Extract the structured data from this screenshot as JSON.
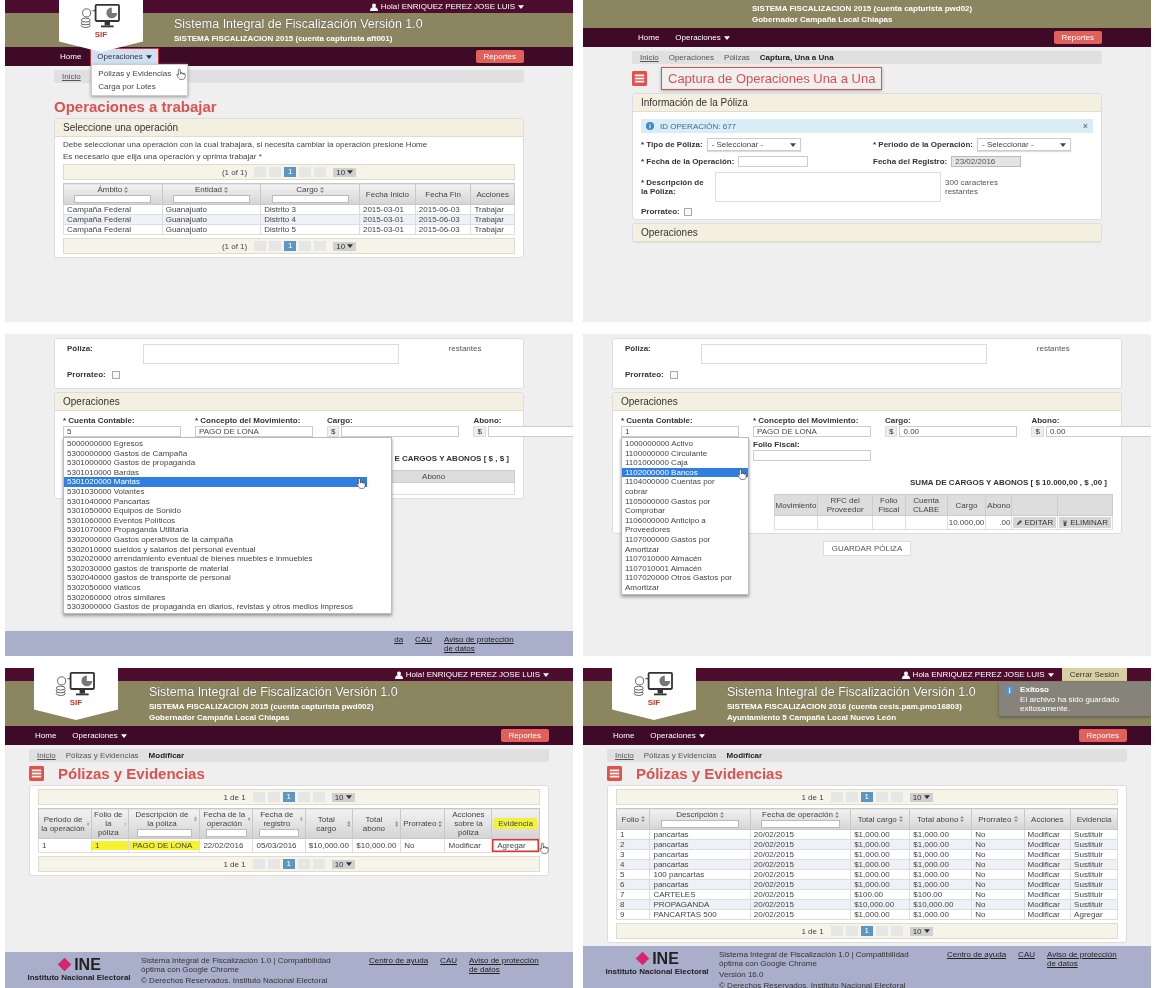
{
  "panels": [
    {
      "header": {
        "logo": "SIF",
        "user": "Hola! ENRIQUEZ PEREZ JOSE LUIS",
        "title": "Sistema Integral de Fiscalización Versión 1.0",
        "subtitles": [
          "SISTEMA FISCALIZACION 2015 (cuenta capturista aft001)"
        ],
        "nav": [
          {
            "label": "Home",
            "selected": false,
            "dropdown": false
          },
          {
            "label": "Operaciones",
            "selected": true,
            "dropdown": true,
            "menu": [
              {
                "label": "Pólizas y Evidencias",
                "hovered": true
              },
              {
                "label": "Carga por Lotes",
                "hovered": false
              }
            ]
          }
        ],
        "reports": "Reportes"
      },
      "sections": [
        {
          "kind": "breadcrumb",
          "items": [
            "Inicio"
          ]
        },
        {
          "kind": "heading",
          "text": "Operaciones a trabajar",
          "icon": false,
          "outlined": false
        },
        {
          "kind": "card",
          "title": "Seleccione una operación",
          "blocks": [
            {
              "kind": "paragraph",
              "text": "Debe seleccionar una operación con la cual trabajará, si necesita cambiar la operación presione Home"
            },
            {
              "kind": "paragraph",
              "text": "Es necesario que elija una operación y oprima trabajar *"
            },
            {
              "kind": "pager",
              "label": "(1 of 1)",
              "pages": [
                {
                  "label": "1",
                  "selected": true
                }
              ],
              "size": "10"
            },
            {
              "kind": "table",
              "columns": [
                {
                  "label": "Ámbito",
                  "sort": true,
                  "filter": true
                },
                {
                  "label": "Entidad",
                  "sort": true,
                  "filter": true
                },
                {
                  "label": "Cargo",
                  "sort": true,
                  "filter": true
                },
                {
                  "label": "Fecha Inicio",
                  "sort": false,
                  "filter": false
                },
                {
                  "label": "Fecha Fin",
                  "sort": false,
                  "filter": false
                },
                {
                  "label": "Acciones",
                  "sort": false,
                  "filter": false
                }
              ],
              "rows": [
                [
                  "Campaña Federal",
                  "Guanajuato",
                  "Distrito 3",
                  "2015-03-01",
                  "2015-06-03",
                  "Trabajar"
                ],
                [
                  "Campaña Federal",
                  "Guanajuato",
                  "Distrito 4",
                  "2015-03-01",
                  "2015-06-03",
                  "Trabajar"
                ],
                [
                  "Campaña Federal",
                  "Guanajuato",
                  "Distrito 5",
                  "2015-03-01",
                  "2015-06-03",
                  "Trabajar"
                ]
              ]
            },
            {
              "kind": "pager",
              "label": "(1 of 1)",
              "pages": [
                {
                  "label": "1",
                  "selected": true
                }
              ],
              "size": "10"
            }
          ]
        }
      ]
    },
    {
      "header": {
        "subtitles": [
          "SISTEMA FISCALIZACION 2015 (cuenta capturista pwd02)",
          "Gobernador Campaña Local Chiapas"
        ],
        "nav": [
          {
            "label": "Home",
            "selected": false,
            "dropdown": false
          },
          {
            "label": "Operaciones",
            "selected": false,
            "dropdown": true
          }
        ],
        "reports": "Reportes"
      },
      "sections": [
        {
          "kind": "breadcrumb",
          "items": [
            "Inicio",
            "Operaciones",
            "Pólizas",
            "Captura, Una a Una"
          ]
        },
        {
          "kind": "heading",
          "text": "Captura de Operaciones Una a Una",
          "icon": true,
          "outlined": true
        },
        {
          "kind": "card",
          "title": "Información de la Póliza",
          "blocks": [
            {
              "kind": "alert",
              "text": "ID OPERACIÓN: 677",
              "close": "×"
            },
            {
              "kind": "form_inline",
              "fields": [
                {
                  "kind": "select",
                  "label": "* Tipo de Póliza:",
                  "value": "- Seleccionar -"
                },
                {
                  "kind": "select",
                  "label": "* Periodo de la Operación:",
                  "value": "- Seleccionar -"
                },
                {
                  "kind": "input",
                  "label": "* Fecha de la Operación:",
                  "disabled": false
                },
                {
                  "kind": "input",
                  "label": "Fecha del Registro:",
                  "value": "23/02/2016",
                  "disabled": true
                },
                {
                  "kind": "textarea",
                  "label": "* Descripción de la Póliza:",
                  "note": "300 caracteres restantes"
                },
                {
                  "kind": "checkbox",
                  "label": "Prorrateo:",
                  "checked": false
                }
              ]
            }
          ]
        },
        {
          "kind": "card",
          "title": "Operaciones"
        }
      ]
    },
    {
      "sections": [
        {
          "kind": "card",
          "blocks": [
            {
              "kind": "form_tail",
              "label": "Póliza:",
              "note": "restantes",
              "checkbox_label": "Prorrateo:",
              "checked": false
            }
          ]
        },
        {
          "kind": "card",
          "title": "Operaciones",
          "blocks": [
            {
              "kind": "form_stacked",
              "list_wide": true,
              "fields": [
                {
                  "kind": "input",
                  "label": "* Cuenta Contable:",
                  "value": "5",
                  "suggestions": [
                    {
                      "label": "5000000000 Egresos",
                      "selected": false
                    },
                    {
                      "label": "5300000000 Gastos de Campaña",
                      "selected": false
                    },
                    {
                      "label": "5301000000 Gastos de propaganda",
                      "selected": false
                    },
                    {
                      "label": "5301010000 Bardas",
                      "selected": false
                    },
                    {
                      "label": "5301020000 Mantas",
                      "selected": true
                    },
                    {
                      "label": "5301030000 Volantes",
                      "selected": false
                    },
                    {
                      "label": "5301040000 Pancartas",
                      "selected": false
                    },
                    {
                      "label": "5301050000 Equipos de Sonido",
                      "selected": false
                    },
                    {
                      "label": "5301060000 Eventos Políticos",
                      "selected": false
                    },
                    {
                      "label": "5301070000 Propaganda Utilitaria",
                      "selected": false
                    },
                    {
                      "label": "5302000000 Gastos operativos de la campaña",
                      "selected": false
                    },
                    {
                      "label": "5302010000 sueldos y salarios del personal eventual",
                      "selected": false
                    },
                    {
                      "label": "5302020000 arrendamiento eventual de bienes muebles e inmuebles",
                      "selected": false
                    },
                    {
                      "label": "5302030000 gastos de transporte de material",
                      "selected": false
                    },
                    {
                      "label": "5302040000 gastos de transporte de personal",
                      "selected": false
                    },
                    {
                      "label": "5302050000 viáticos",
                      "selected": false
                    },
                    {
                      "label": "5302060000 otros similares",
                      "selected": false
                    },
                    {
                      "label": "5303000000 Gastos de propaganda en diarios, revistas y otros medios impresos",
                      "selected": false
                    }
                  ]
                },
                {
                  "kind": "input",
                  "label": "* Concepto del Movimiento:",
                  "value": "PAGO DE LONA"
                },
                {
                  "kind": "money",
                  "label": "Cargo:",
                  "prefix": "$"
                },
                {
                  "kind": "money",
                  "label": "Abono:",
                  "prefix": "$"
                }
              ]
            },
            {
              "kind": "sum",
              "text": "E CARGOS Y ABONOS [ $   , $   ]"
            },
            {
              "kind": "ops_table",
              "columns": [
                "Abono"
              ]
            }
          ]
        }
      ],
      "footer": {
        "links": [
          "da",
          "CAU",
          "Aviso de protección de datos"
        ]
      }
    },
    {
      "sections": [
        {
          "kind": "card",
          "blocks": [
            {
              "kind": "form_tail",
              "label": "Póliza:",
              "note": "restantes",
              "checkbox_label": "Prorrateo:",
              "checked": false
            }
          ]
        },
        {
          "kind": "card",
          "title": "Operaciones",
          "blocks": [
            {
              "kind": "form_stacked",
              "list_wide": false,
              "fields": [
                {
                  "kind": "input",
                  "label": "* Cuenta Contable:",
                  "value": "1",
                  "suggestions": [
                    {
                      "label": "1000000000 Activo",
                      "selected": false
                    },
                    {
                      "label": "1100000000 Circulante",
                      "selected": false
                    },
                    {
                      "label": "1101000000 Caja",
                      "selected": false
                    },
                    {
                      "label": "1102000000 Bancos",
                      "selected": true
                    },
                    {
                      "label": "1104000000 Cuentas por cobrar",
                      "selected": false
                    },
                    {
                      "label": "1105000000 Gastos por Comprobar",
                      "selected": false
                    },
                    {
                      "label": "1106000000 Anticipo a Proveedores",
                      "selected": false
                    },
                    {
                      "label": "1107000000 Gastos por Amortizar",
                      "selected": false
                    },
                    {
                      "label": "1107010000 Almacén",
                      "selected": false
                    },
                    {
                      "label": "1107010001 Almacén",
                      "selected": false
                    },
                    {
                      "label": "1107020000 Otros Gastos por Amortizar",
                      "selected": false
                    }
                  ]
                },
                {
                  "kind": "input",
                  "label": "* Concepto del Movimiento:",
                  "value": "PAGO DE LONA"
                },
                {
                  "kind": "money",
                  "label": "Cargo:",
                  "prefix": "$",
                  "value": "0.00"
                },
                {
                  "kind": "money",
                  "label": "Abono:",
                  "prefix": "$",
                  "value": "0.00"
                },
                {
                  "kind": "input",
                  "label": "Folio Fiscal:"
                }
              ]
            },
            {
              "kind": "sum",
              "text": "SUMA DE CARGOS Y ABONOS [ $  10.000,00  , $  ,00 ]"
            },
            {
              "kind": "ops_table",
              "columns": [
                "Movimiento",
                "RFC del Proveedor",
                "Folio Fiscal",
                "Cuenta CLABE",
                "Cargo",
                "Abono"
              ],
              "rows": [
                {
                  "cells": [
                    null,
                    null,
                    null,
                    null,
                    "10.000,00",
                    ".00"
                  ],
                  "actions": [
                    {
                      "kind": "edit",
                      "label": "EDITAR"
                    },
                    {
                      "kind": "delete",
                      "label": "ELIMINAR"
                    }
                  ]
                }
              ]
            }
          ]
        },
        {
          "kind": "button",
          "label": "GUARDAR PÓLIZA"
        }
      ]
    },
    {
      "header": {
        "logo": "SIF",
        "user": "Hola! ENRIQUEZ PEREZ JOSE LUIS",
        "title": "Sistema Integral de Fiscalización Versión 1.0",
        "subtitles": [
          "SISTEMA FISCALIZACION 2015 (cuenta capturista pwd002)",
          "Gobernador Campaña Local Chiapas"
        ],
        "nav": [
          {
            "label": "Home",
            "selected": false,
            "dropdown": false
          },
          {
            "label": "Operaciones",
            "selected": false,
            "dropdown": true
          }
        ],
        "reports": "Reportes"
      },
      "sections": [
        {
          "kind": "breadcrumb",
          "items": [
            "Inicio",
            "Pólizas y Evidencias",
            "Modificar"
          ]
        },
        {
          "kind": "heading",
          "text": "Pólizas y Evidencias",
          "icon": true,
          "outlined": false
        },
        {
          "kind": "card",
          "blocks": [
            {
              "kind": "pager",
              "label": "1 de 1",
              "pages": [
                {
                  "label": "1",
                  "selected": true
                }
              ],
              "size": "10"
            },
            {
              "kind": "table",
              "columns": [
                {
                  "label": "Periodo de la operación",
                  "sort": true,
                  "filter": false,
                  "highlighted": false
                },
                {
                  "label": "Folio de la póliza",
                  "sort": true,
                  "filter": false,
                  "highlighted": false
                },
                {
                  "label": "Descripción de la póliza",
                  "sort": true,
                  "filter": true,
                  "highlighted": false
                },
                {
                  "label": "Fecha de la operación",
                  "sort": true,
                  "filter": true,
                  "highlighted": false
                },
                {
                  "label": "Fecha de registro",
                  "sort": true,
                  "filter": true,
                  "highlighted": false
                },
                {
                  "label": "Total cargo",
                  "sort": true,
                  "filter": false,
                  "highlighted": false
                },
                {
                  "label": "Total abono",
                  "sort": true,
                  "filter": false,
                  "highlighted": false
                },
                {
                  "label": "Prorrateo",
                  "sort": true,
                  "filter": false,
                  "highlighted": false
                },
                {
                  "label": "Acciones sobre la póliza",
                  "sort": false,
                  "filter": false,
                  "highlighted": false
                },
                {
                  "label": "Evidencia",
                  "sort": false,
                  "filter": false,
                  "highlighted": true
                }
              ],
              "rows": [
                {
                  "cells": [
                    {
                      "text": "1",
                      "highlighted": false,
                      "outlined": false
                    },
                    {
                      "text": "1",
                      "highlighted": true,
                      "outlined": false
                    },
                    {
                      "text": "PAGO DE LONA",
                      "highlighted": true,
                      "outlined": false
                    },
                    {
                      "text": "22/02/2016",
                      "highlighted": false,
                      "outlined": false
                    },
                    {
                      "text": "05/03/2016",
                      "highlighted": false,
                      "outlined": false
                    },
                    {
                      "text": "$10,000.00",
                      "highlighted": false,
                      "outlined": false
                    },
                    {
                      "text": "$10,000.00",
                      "highlighted": false,
                      "outlined": false
                    },
                    {
                      "text": "No",
                      "highlighted": false,
                      "outlined": false
                    },
                    {
                      "text": "Modificar",
                      "highlighted": false,
                      "outlined": false
                    },
                    {
                      "text": "Agregar",
                      "highlighted": false,
                      "outlined": true
                    }
                  ]
                }
              ]
            },
            {
              "kind": "pager",
              "label": "1 de 1",
              "pages": [
                {
                  "label": "1",
                  "selected": true
                }
              ],
              "size": "10"
            }
          ]
        }
      ],
      "footer": {
        "logo": "INE",
        "logo_subtitle": "Instituto Nacional Electoral",
        "lines": [
          "Sistema Integral de Fiscalización 1.0 | Compatibilidad óptima con Google Chrome",
          "© Derechos Reservados. Instituto Nacional Electoral"
        ],
        "links": [
          "Centro de ayuda",
          "CAU",
          "Aviso de protección de datos"
        ]
      }
    },
    {
      "header": {
        "logo": "SIF",
        "user": "Hola ENRIQUEZ PEREZ JOSE LUIS",
        "logout": "Cerrar Sesión",
        "toast": {
          "title": "Exitoso",
          "message": "El archivo ha sido guardado exitosamente."
        },
        "title": "Sistema Integral de Fiscalización Versión 1.0",
        "subtitles": [
          "SISTEMA FISCALIZACION 2016 (cuenta cesis.pam.pmo16803)",
          "Ayuntamiento 5 Campaña Local Nuevo León"
        ],
        "nav": [
          {
            "label": "Home",
            "selected": false,
            "dropdown": false
          },
          {
            "label": "Operaciones",
            "selected": false,
            "dropdown": true
          }
        ],
        "reports": "Reportes"
      },
      "sections": [
        {
          "kind": "breadcrumb",
          "items": [
            "Inicio",
            "Pólizas y Evidencias",
            "Modificar"
          ]
        },
        {
          "kind": "heading",
          "text": "Pólizas y Evidencias",
          "icon": true,
          "outlined": false
        },
        {
          "kind": "card",
          "blocks": [
            {
              "kind": "pager",
              "label": "1 de 1",
              "pages": [
                {
                  "label": "1",
                  "selected": true
                }
              ],
              "size": "10"
            },
            {
              "kind": "table",
              "columns": [
                {
                  "label": "Folio",
                  "sort": true,
                  "filter": false
                },
                {
                  "label": "Descripción",
                  "sort": true,
                  "filter": true
                },
                {
                  "label": "Fecha de operación",
                  "sort": true,
                  "filter": true
                },
                {
                  "label": "Total cargo",
                  "sort": true,
                  "filter": false
                },
                {
                  "label": "Total abono",
                  "sort": true,
                  "filter": false
                },
                {
                  "label": "Prorrateo",
                  "sort": true,
                  "filter": false
                },
                {
                  "label": "Acciones",
                  "sort": false,
                  "filter": false
                },
                {
                  "label": "Evidencia",
                  "sort": false,
                  "filter": false
                }
              ],
              "rows": [
                [
                  "1",
                  "pancartas",
                  "20/02/2015",
                  "$1,000.00",
                  "$1,000.00",
                  "No",
                  "Modificar",
                  "Sustituir"
                ],
                [
                  "2",
                  "pancartas",
                  "20/02/2015",
                  "$1,000.00",
                  "$1,000.00",
                  "No",
                  "Modificar",
                  "Sustituir"
                ],
                [
                  "3",
                  "pancartas",
                  "20/02/2015",
                  "$1,000.00",
                  "$1,000.00",
                  "No",
                  "Modificar",
                  "Sustituir"
                ],
                [
                  "4",
                  "pancartas",
                  "20/02/2015",
                  "$1,000.00",
                  "$1,000.00",
                  "No",
                  "Modificar",
                  "Sustituir"
                ],
                [
                  "5",
                  "100 pancartas",
                  "20/02/2015",
                  "$1,000.00",
                  "$1,000.00",
                  "No",
                  "Modificar",
                  "Sustituir"
                ],
                [
                  "6",
                  "pancartas",
                  "20/02/2015",
                  "$1,000.00",
                  "$1,000.00",
                  "No",
                  "Modificar",
                  "Sustituir"
                ],
                [
                  "7",
                  "CARTELES",
                  "20/02/2015",
                  "$100.00",
                  "$100.00",
                  "No",
                  "Modificar",
                  "Sustituir"
                ],
                [
                  "8",
                  "PROPAGANDA",
                  "20/02/2015",
                  "$10,000.00",
                  "$10,000.00",
                  "No",
                  "Modificar",
                  "Sustituir"
                ],
                [
                  "9",
                  "PANCARTAS 500",
                  "20/02/2015",
                  "$1,000.00",
                  "$1,000.00",
                  "No",
                  "Modificar",
                  "Agregar"
                ]
              ]
            },
            {
              "kind": "pager",
              "label": "1 de 1",
              "pages": [
                {
                  "label": "1",
                  "selected": true
                }
              ],
              "size": "10"
            }
          ]
        }
      ],
      "footer": {
        "logo": "INE",
        "logo_subtitle": "Instituto Nacional Electoral",
        "lines": [
          "Sistema Integral de Fiscalización 1.0 | Compatibilidad óptima con Google Chrome",
          "Versión 16.0",
          "© Derechos Reservados. Instituto Nacional Electoral"
        ],
        "links": [
          "Centro de ayuda",
          "CAU",
          "Aviso de protección de datos"
        ]
      }
    }
  ]
}
